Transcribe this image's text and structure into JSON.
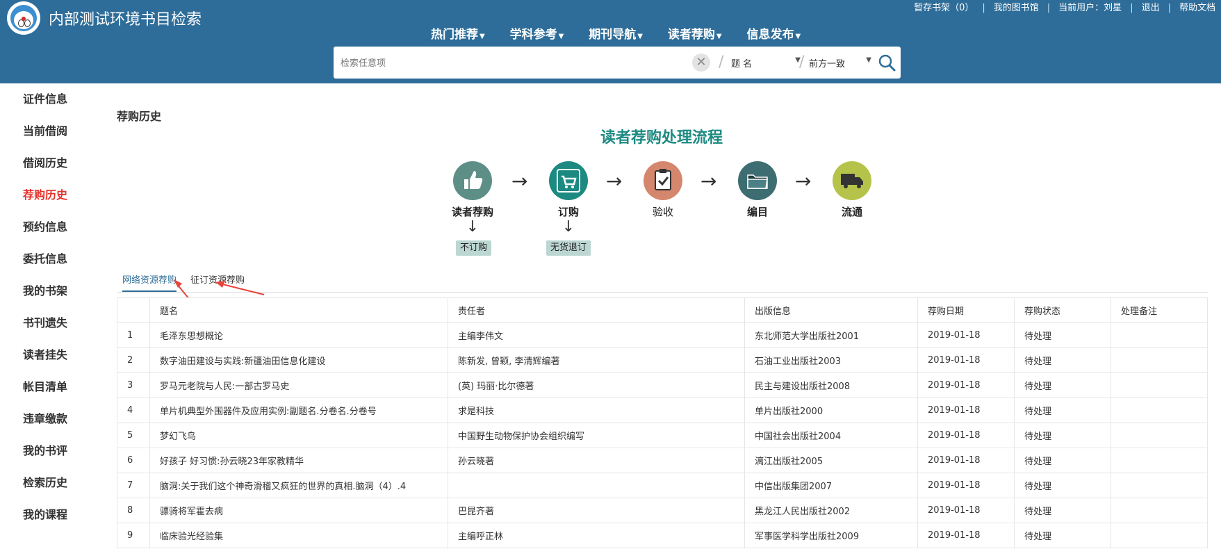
{
  "header": {
    "site_title": "内部测试环境书目检索",
    "top_links": [
      "暂存书架（0）",
      "我的图书馆",
      "当前用户：刘星",
      "退出",
      "帮助文档"
    ],
    "nav": [
      "热门推荐",
      "学科参考",
      "期刊导航",
      "读者荐购",
      "信息发布"
    ],
    "search": {
      "placeholder": "检索任意项",
      "field": "题 名",
      "match": "前方一致"
    }
  },
  "sidebar": {
    "items": [
      "证件信息",
      "当前借阅",
      "借阅历史",
      "荐购历史",
      "预约信息",
      "委托信息",
      "我的书架",
      "书刊遗失",
      "读者挂失",
      "帐目清单",
      "违章缴款",
      "我的书评",
      "检索历史",
      "我的课程"
    ],
    "active": "荐购历史"
  },
  "main": {
    "heading": "荐购历史",
    "flow_title": "读者荐购处理流程",
    "steps": [
      {
        "label": "读者荐购",
        "color": "#5d8f86",
        "icon": "thumbs-up-icon"
      },
      {
        "label": "订购",
        "color": "#1d8a82",
        "icon": "cart-icon"
      },
      {
        "label": "验收",
        "color": "#d4876c",
        "icon": "clipboard-check-icon"
      },
      {
        "label": "编目",
        "color": "#3d6d71",
        "icon": "folder-icon"
      },
      {
        "label": "流通",
        "color": "#b6c34a",
        "icon": "truck-icon"
      }
    ],
    "branches": [
      "不订购",
      "无货退订"
    ],
    "tabs": [
      "网络资源荐购",
      "征订资源荐购"
    ],
    "table": {
      "headers": [
        "",
        "题名",
        "责任者",
        "出版信息",
        "荐购日期",
        "荐购状态",
        "处理备注"
      ],
      "rows": [
        [
          "1",
          "毛泽东思想概论",
          "主编李伟文",
          "东北师范大学出版社2001",
          "2019-01-18",
          "待处理",
          ""
        ],
        [
          "2",
          "数字油田建设与实践:新疆油田信息化建设",
          "陈新发, 曾颖, 李清辉编著",
          "石油工业出版社2003",
          "2019-01-18",
          "待处理",
          ""
        ],
        [
          "3",
          "罗马元老院与人民:一部古罗马史",
          "(英) 玛丽·比尔德著",
          "民主与建设出版社2008",
          "2019-01-18",
          "待处理",
          ""
        ],
        [
          "4",
          "单片机典型外围器件及应用实例:副题名.分卷名.分卷号",
          "求是科技",
          "单片出版社2000",
          "2019-01-18",
          "待处理",
          ""
        ],
        [
          "5",
          "梦幻飞鸟",
          "中国野生动物保护协会组织编写",
          "中国社会出版社2004",
          "2019-01-18",
          "待处理",
          ""
        ],
        [
          "6",
          "好孩子 好习惯:孙云晓23年家教精华",
          "孙云晓著",
          "漓江出版社2005",
          "2019-01-18",
          "待处理",
          ""
        ],
        [
          "7",
          "脑洞:关于我们这个神奇滑稽又疯狂的世界的真相.脑洞（4）.4",
          "",
          "中信出版集团2007",
          "2019-01-18",
          "待处理",
          ""
        ],
        [
          "8",
          "骠骑将军霍去病",
          "巴昆齐著",
          "黑龙江人民出版社2002",
          "2019-01-18",
          "待处理",
          ""
        ],
        [
          "9",
          "临床验光经验集",
          "主编呼正林",
          "军事医学科学出版社2009",
          "2019-01-18",
          "待处理",
          ""
        ]
      ]
    }
  }
}
